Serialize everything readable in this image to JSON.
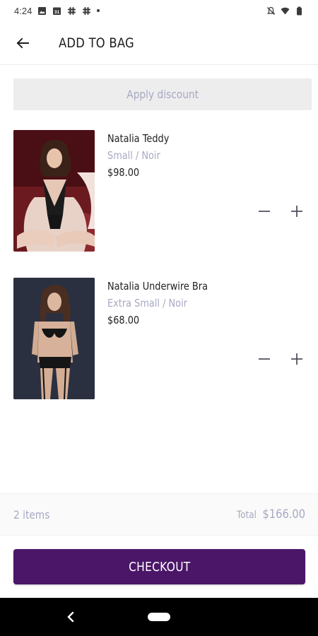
{
  "status_bar": {
    "time": "4:24",
    "icons": [
      "image-icon",
      "calendar-icon",
      "slack-icon",
      "slack-icon",
      "dot-icon",
      "mute-icon",
      "wifi-icon",
      "battery-icon"
    ],
    "calendar_day": "31"
  },
  "header": {
    "back_icon": "arrow-left-icon",
    "title": "ADD TO BAG"
  },
  "discount": {
    "label": "Apply discount"
  },
  "cart": {
    "items": [
      {
        "name": "Natalia Teddy",
        "variant": "Small / Noir",
        "price": "$98.00",
        "image_icon": "product-photo"
      },
      {
        "name": "Natalia Underwire Bra",
        "variant": "Extra Small / Noir",
        "price": "$68.00",
        "image_icon": "product-photo"
      }
    ]
  },
  "summary": {
    "items_count": "2 items",
    "total_label": "Total",
    "total_value": "$166.00"
  },
  "checkout": {
    "label": "CHECKOUT"
  },
  "colors": {
    "accent": "#4b1668",
    "muted_text": "#a7a9c3",
    "discount_bg": "#ededee"
  },
  "nav": {
    "back_icon": "nav-back-icon",
    "home_icon": "nav-home-pill"
  }
}
